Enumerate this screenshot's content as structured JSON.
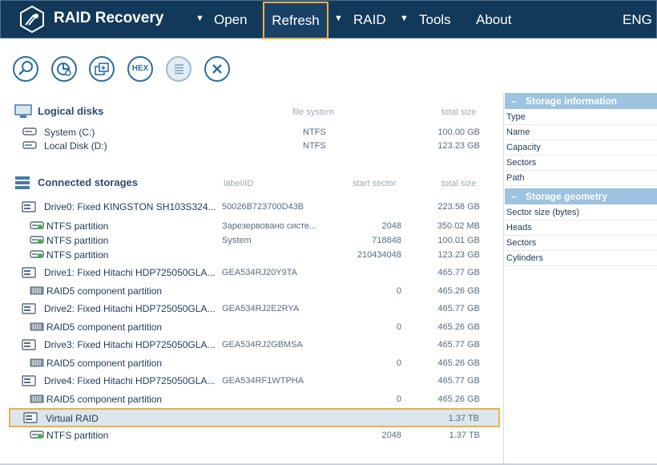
{
  "header": {
    "app_title": "RAID Recovery",
    "menu": {
      "open": "Open",
      "refresh": "Refresh",
      "raid": "RAID",
      "tools": "Tools",
      "about": "About",
      "lang": "ENG"
    },
    "caret": "▼"
  },
  "toolbar": {
    "buttons": [
      "search-icon",
      "pie-chart-icon",
      "save-icon",
      "hex-icon",
      "list-icon",
      "close-icon"
    ],
    "hex_label": "HEX"
  },
  "logical_disks": {
    "title": "Logical disks",
    "col_fs": "file system",
    "col_size": "total size",
    "rows": [
      {
        "name": "System (C:)",
        "fs": "NTFS",
        "size": "100.00 GB"
      },
      {
        "name": "Local Disk (D:)",
        "fs": "NTFS",
        "size": "123.23 GB"
      }
    ]
  },
  "connected_storages": {
    "title": "Connected storages",
    "col_label": "label/ID",
    "col_start": "start sector",
    "col_size": "total size",
    "rows": [
      {
        "kind": "drive",
        "name": "Drive0: Fixed KINGSTON SH103S324...",
        "label": "50026B723700D43B",
        "start": "",
        "size": "223.58 GB"
      },
      {
        "kind": "partition",
        "name": "NTFS partition",
        "label": "Зарезервовано систе...",
        "start": "2048",
        "size": "350.02 MB"
      },
      {
        "kind": "partition",
        "name": "NTFS partition",
        "label": "System",
        "start": "718848",
        "size": "100.01 GB"
      },
      {
        "kind": "partition",
        "name": "NTFS partition",
        "label": "",
        "start": "210434048",
        "size": "123.23 GB"
      },
      {
        "kind": "drive",
        "name": "Drive1: Fixed Hitachi HDP725050GLA...",
        "label": "GEA534RJ20Y9TA",
        "start": "",
        "size": "465.77 GB"
      },
      {
        "kind": "raid-part",
        "name": "RAID5 component partition",
        "label": "",
        "start": "0",
        "size": "465.26 GB"
      },
      {
        "kind": "drive",
        "name": "Drive2: Fixed Hitachi HDP725050GLA...",
        "label": "GEA534RJ2E2RYA",
        "start": "",
        "size": "465.77 GB"
      },
      {
        "kind": "raid-part",
        "name": "RAID5 component partition",
        "label": "",
        "start": "0",
        "size": "465.26 GB"
      },
      {
        "kind": "drive",
        "name": "Drive3: Fixed Hitachi HDP725050GLA...",
        "label": "GEA534RJ2GBMSA",
        "start": "",
        "size": "465.77 GB"
      },
      {
        "kind": "raid-part",
        "name": "RAID5 component partition",
        "label": "",
        "start": "0",
        "size": "465.26 GB"
      },
      {
        "kind": "drive",
        "name": "Drive4: Fixed Hitachi HDP725050GLA...",
        "label": "GEA534RF1WTPHA",
        "start": "",
        "size": "465.77 GB"
      },
      {
        "kind": "raid-part",
        "name": "RAID5 component partition",
        "label": "",
        "start": "0",
        "size": "465.26 GB"
      },
      {
        "kind": "virtual-raid",
        "name": "Virtual RAID",
        "label": "",
        "start": "",
        "size": "1.37 TB"
      },
      {
        "kind": "partition",
        "name": "NTFS partition",
        "label": "",
        "start": "2048",
        "size": "1.37 TB"
      }
    ]
  },
  "info_panel": {
    "storage_information": {
      "title": "Storage information",
      "fields": [
        "Type",
        "Name",
        "Capacity",
        "Sectors",
        "Path"
      ]
    },
    "storage_geometry": {
      "title": "Storage geometry",
      "fields": [
        "Sector size (bytes)",
        "Heads",
        "Sectors",
        "Cylinders"
      ]
    },
    "dash": "–"
  },
  "colors": {
    "header_bg": "#12395a",
    "accent": "#e9b24a",
    "panel_head": "#9ec3e0",
    "selection": "#dde5ed"
  }
}
